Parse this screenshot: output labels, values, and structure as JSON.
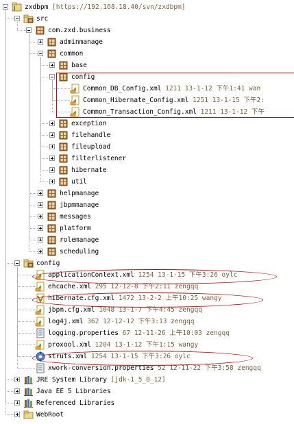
{
  "tree": {
    "items": [
      {
        "depth": 0,
        "label": "zxdbpm",
        "meta": " [https://192.168.18.40/svn/zxdbpm]",
        "icon": "project-icon",
        "toggle": "minus"
      },
      {
        "depth": 1,
        "label": "src",
        "meta": "",
        "icon": "source-folder-icon",
        "toggle": "minus"
      },
      {
        "depth": 2,
        "label": "com.zxd.business",
        "meta": "",
        "icon": "package-icon",
        "toggle": "minus"
      },
      {
        "depth": 3,
        "label": "adminmanage",
        "meta": "",
        "icon": "package-icon",
        "toggle": "plus"
      },
      {
        "depth": 3,
        "label": "common",
        "meta": "",
        "icon": "package-icon",
        "toggle": "minus"
      },
      {
        "depth": 4,
        "label": "base",
        "meta": "",
        "icon": "package-icon",
        "toggle": "plus"
      },
      {
        "depth": 4,
        "label": "config",
        "meta": "",
        "icon": "package-icon",
        "toggle": "minus"
      },
      {
        "depth": 5,
        "label": "Common_DB_Config.xml",
        "meta": " 1211  13-1-12 下午1:41  wan",
        "icon": "xml-file-icon",
        "toggle": ""
      },
      {
        "depth": 5,
        "label": "Common_Hibernate_Config.xml",
        "meta": " 1251  13-1-15 下午2:",
        "icon": "xml-file-icon",
        "toggle": ""
      },
      {
        "depth": 5,
        "label": "Common_Transaction_Config.xml",
        "meta": " 1211  13-1-12 下午",
        "icon": "xml-file-icon",
        "toggle": ""
      },
      {
        "depth": 4,
        "label": "exception",
        "meta": "",
        "icon": "package-icon",
        "toggle": "plus"
      },
      {
        "depth": 4,
        "label": "filehandle",
        "meta": "",
        "icon": "package-icon",
        "toggle": "plus"
      },
      {
        "depth": 4,
        "label": "fileupload",
        "meta": "",
        "icon": "package-icon",
        "toggle": "plus"
      },
      {
        "depth": 4,
        "label": "filterlistener",
        "meta": "",
        "icon": "package-icon",
        "toggle": "plus"
      },
      {
        "depth": 4,
        "label": "hibernate",
        "meta": "",
        "icon": "package-icon",
        "toggle": "plus"
      },
      {
        "depth": 4,
        "label": "util",
        "meta": "",
        "icon": "package-icon",
        "toggle": "plus"
      },
      {
        "depth": 3,
        "label": "helpmanage",
        "meta": "",
        "icon": "package-icon",
        "toggle": "plus"
      },
      {
        "depth": 3,
        "label": "jbpmmanage",
        "meta": "",
        "icon": "package-icon",
        "toggle": "plus"
      },
      {
        "depth": 3,
        "label": "messages",
        "meta": "",
        "icon": "package-icon",
        "toggle": "plus"
      },
      {
        "depth": 3,
        "label": "platform",
        "meta": "",
        "icon": "package-icon",
        "toggle": "plus"
      },
      {
        "depth": 3,
        "label": "rolemanage",
        "meta": "",
        "icon": "package-icon",
        "toggle": "plus"
      },
      {
        "depth": 3,
        "label": "scheduling",
        "meta": "",
        "icon": "package-icon",
        "toggle": "plus"
      },
      {
        "depth": 1,
        "label": "config",
        "meta": "",
        "icon": "source-folder-icon",
        "toggle": "minus"
      },
      {
        "depth": 2,
        "label": "applicationContext.xml",
        "meta": " 1254  13-1-15 下午3:26  oylc",
        "icon": "xml-file-icon",
        "toggle": ""
      },
      {
        "depth": 2,
        "label": "ehcache.xml",
        "meta": " 295  12-12-8 下午2:11  zengqq",
        "icon": "xml-file-icon",
        "toggle": ""
      },
      {
        "depth": 2,
        "label": "hibernate.cfg.xml",
        "meta": " 1472  13-2-2 上午10:25  wangy",
        "icon": "hibernate-file-icon",
        "toggle": ""
      },
      {
        "depth": 2,
        "label": "jbpm.cfg.xml",
        "meta": " 1048  13-1-7 下午4:45  zengqq",
        "icon": "xml-file-icon",
        "toggle": ""
      },
      {
        "depth": 2,
        "label": "log4j.xml",
        "meta": " 362  12-12-12 下午3:13  zengqq",
        "icon": "xml-file-icon",
        "toggle": ""
      },
      {
        "depth": 2,
        "label": "logging.properties",
        "meta": " 67  12-11-26 上午10:03  zengqq",
        "icon": "properties-file-icon",
        "toggle": ""
      },
      {
        "depth": 2,
        "label": "proxool.xml",
        "meta": " 1204  13-1-12 下午1:15  wangy",
        "icon": "xml-file-icon",
        "toggle": ""
      },
      {
        "depth": 2,
        "label": "struts.xml",
        "meta": " 1254  13-1-15 下午3:26  oylc",
        "icon": "struts-file-icon",
        "toggle": ""
      },
      {
        "depth": 2,
        "label": "xwork-conversion.properties",
        "meta": " 52  12-11-22 下午3:58  zengqq",
        "icon": "properties-file-icon",
        "toggle": ""
      },
      {
        "depth": 1,
        "label": "JRE System Library",
        "meta": " [jdk-1_5_0_12]",
        "icon": "library-icon",
        "toggle": "plus"
      },
      {
        "depth": 1,
        "label": "Java EE 5 Libraries",
        "meta": "",
        "icon": "library-icon",
        "toggle": "plus"
      },
      {
        "depth": 1,
        "label": "Referenced Libraries",
        "meta": "",
        "icon": "library-icon",
        "toggle": "plus"
      },
      {
        "depth": 1,
        "label": "WebRoot",
        "meta": "",
        "icon": "folder-icon",
        "toggle": "plus"
      }
    ]
  },
  "colors": {
    "annotation": "#d60000",
    "meta_text": "#7b5f3a",
    "package_brown": "#a0662b",
    "xml_orange": "#e8a33b",
    "leaf_green": "#7ab33e"
  }
}
